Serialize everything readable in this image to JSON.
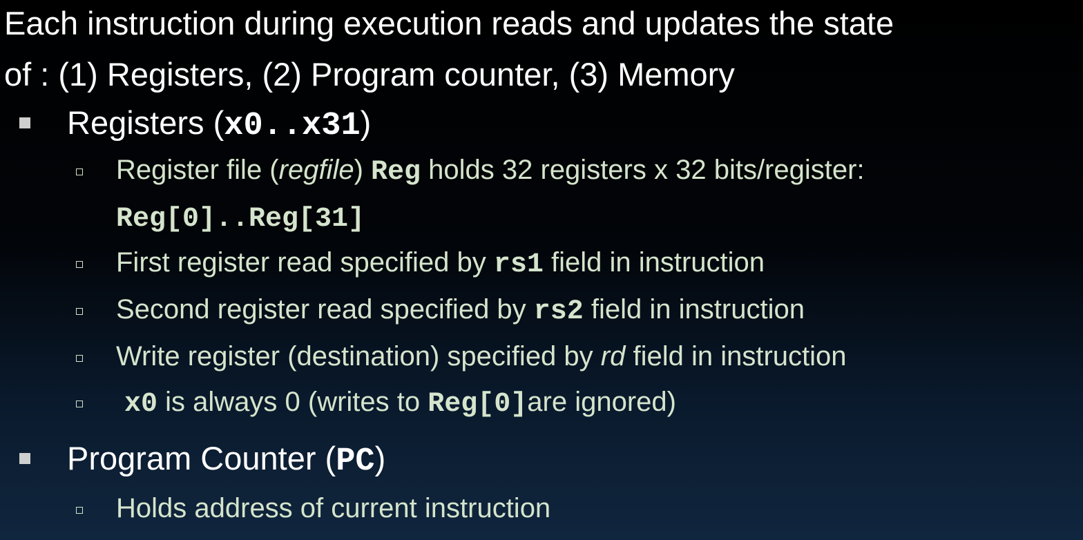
{
  "intro": {
    "line1": "Each instruction during execution reads and updates the state",
    "line2": "of : (1) Registers, (2) Program counter, (3) Memory"
  },
  "registers": {
    "heading_prefix": "Registers (",
    "heading_code": "x0..x31",
    "heading_suffix": ")",
    "items": [
      {
        "pre": "Register file (",
        "italic": "regfile",
        "mid": ") ",
        "code": "Reg",
        "post": " holds 32 registers x 32 bits/register:",
        "code2": "Reg[0]..Reg[31]"
      },
      {
        "pre": "First register read specified by ",
        "code": "rs1",
        "post": " field in instruction"
      },
      {
        "pre": "Second register read specified by ",
        "code": "rs2",
        "post": " field in instruction"
      },
      {
        "pre": "Write register (destination) specified by ",
        "italic": "rd",
        "post": " field in instruction"
      },
      {
        "code": "x0",
        "mid": " is always 0 (writes to ",
        "code2": "Reg[0]",
        "post": "are ignored)"
      }
    ]
  },
  "pc": {
    "heading_prefix": "Program Counter (",
    "heading_code": "PC",
    "heading_suffix": ")",
    "items": [
      {
        "text": "Holds address of current instruction"
      }
    ]
  }
}
